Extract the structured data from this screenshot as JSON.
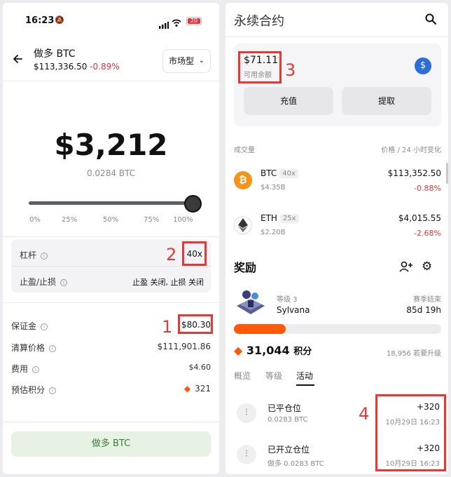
{
  "status_bar": {
    "time": "16:23",
    "battery": "20"
  },
  "order": {
    "title": "做多 BTC",
    "price": "$113,336.50",
    "change": "-0.89%",
    "order_type": "市场型",
    "amount": "$3,212",
    "amount_btc": "0.0284 BTC",
    "slider_ticks": [
      "0%",
      "25%",
      "50%",
      "75%",
      "100%"
    ],
    "slider_value_percent": 100,
    "leverage_label": "杠杆",
    "leverage_value": "40x",
    "tpsl_label": "止盈/止损",
    "tpsl_value": "止盈 关闭, 止损 关闭",
    "margin_label": "保证金",
    "margin_value": "$80.30",
    "liq_label": "清算价格",
    "liq_value": "$111,901.86",
    "fee_label": "费用",
    "fee_value": "$4.60",
    "points_label": "预估积分",
    "points_value": "321",
    "submit_label": "做多 BTC"
  },
  "perps": {
    "title": "永续合约",
    "balance": "$71.11",
    "balance_label": "可用余额",
    "deposit_label": "充值",
    "withdraw_label": "提取",
    "volume_header": "成交量",
    "price_header": "价格 / 24 小时变化",
    "markets": [
      {
        "symbol": "BTC",
        "leverage": "40x",
        "volume": "$4.35B",
        "price": "$113,352.50",
        "change": "-0.88%"
      },
      {
        "symbol": "ETH",
        "leverage": "25x",
        "volume": "$2.20B",
        "price": "$4,015.55",
        "change": "-2.68%"
      }
    ]
  },
  "rewards": {
    "title": "奖励",
    "level_label": "等级 3",
    "username": "Sylvana",
    "season_label": "赛季结束",
    "season_remaining": "85d 19h",
    "progress_fraction": 0.25,
    "points": "31,044",
    "points_unit": "积分",
    "upgrade_text": "18,956 若要升级",
    "tabs": [
      "概览",
      "等级",
      "活动"
    ],
    "active_tab": 2,
    "activities": [
      {
        "title": "已平仓位",
        "detail": "0.0283 BTC",
        "points": "+320",
        "date": "10月29日 16:23"
      },
      {
        "title": "已开立仓位",
        "detail": "做多 0.0283 BTC",
        "points": "+320",
        "date": "10月29日 16:23"
      }
    ]
  },
  "annotations": {
    "margin": "1",
    "leverage": "2",
    "balance": "3",
    "activity": "4"
  },
  "colors": {
    "accent_orange": "#ff5a0a",
    "negative": "#e0373f",
    "annotation_red": "#e53935",
    "submit_bg": "#e8f2e4",
    "submit_text": "#3d7d3a"
  }
}
